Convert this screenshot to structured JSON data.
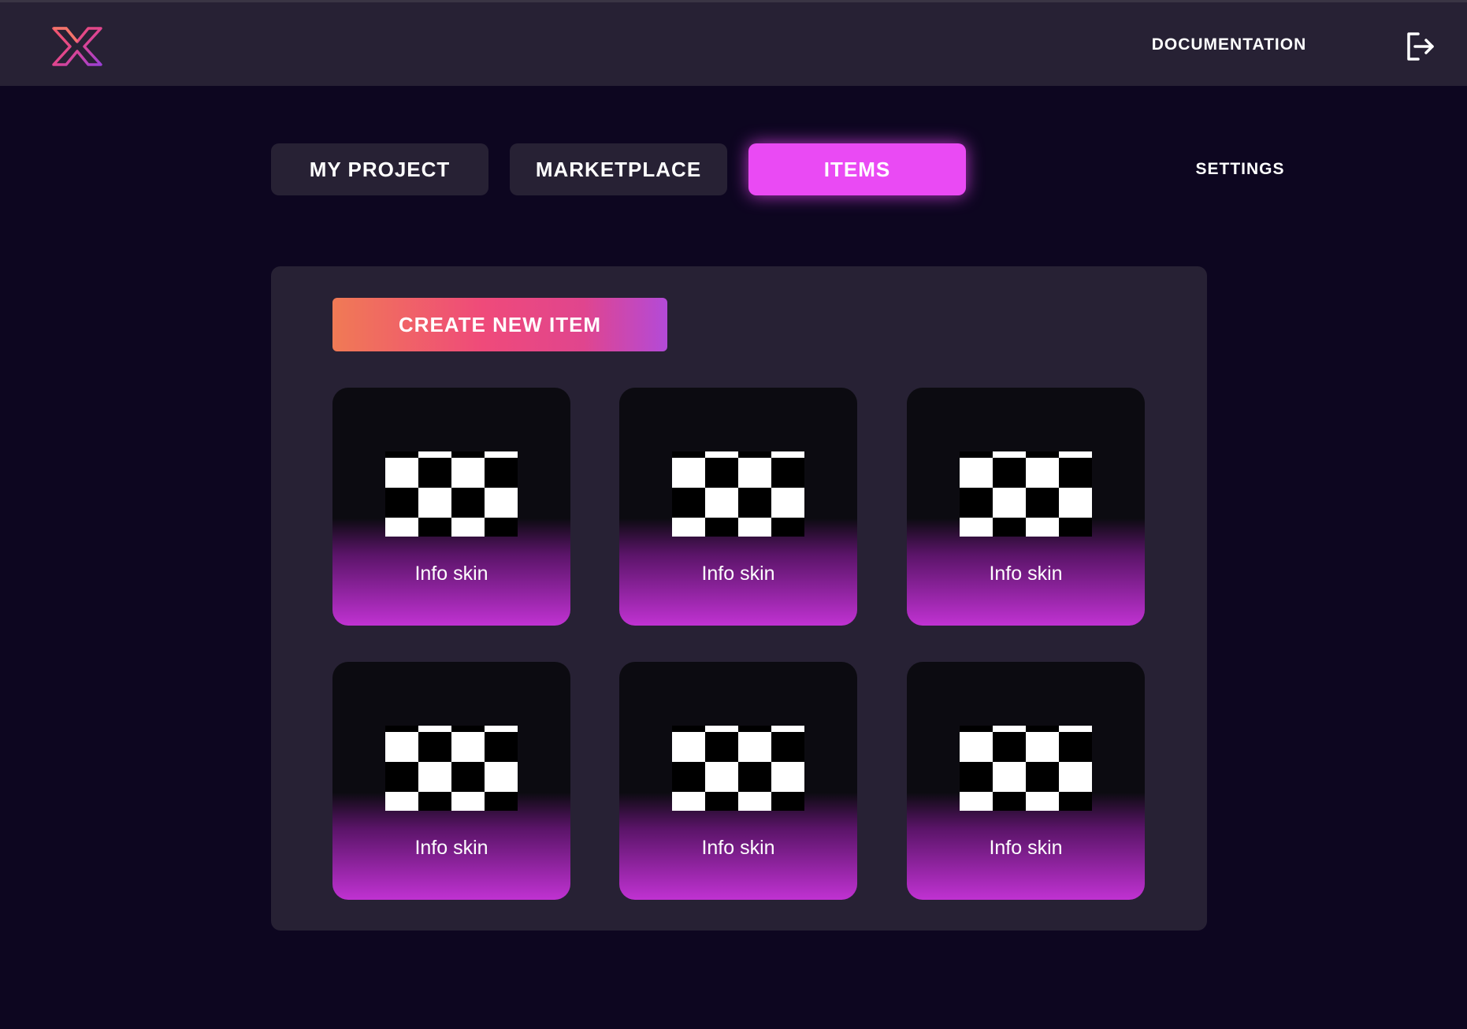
{
  "header": {
    "logo_icon": "x-logo-icon",
    "documentation_label": "DOCUMENTATION",
    "logout_icon": "logout-icon"
  },
  "tabs": [
    {
      "label": "MY PROJECT",
      "active": false
    },
    {
      "label": "MARKETPLACE",
      "active": false
    },
    {
      "label": "ITEMS",
      "active": true
    }
  ],
  "settings_label": "SETTINGS",
  "panel": {
    "create_button_label": "CREATE NEW ITEM",
    "items": [
      {
        "label": "Info skin",
        "thumbnail_icon": "checkerboard-placeholder-icon"
      },
      {
        "label": "Info skin",
        "thumbnail_icon": "checkerboard-placeholder-icon"
      },
      {
        "label": "Info skin",
        "thumbnail_icon": "checkerboard-placeholder-icon"
      },
      {
        "label": "Info skin",
        "thumbnail_icon": "checkerboard-placeholder-icon"
      },
      {
        "label": "Info skin",
        "thumbnail_icon": "checkerboard-placeholder-icon"
      },
      {
        "label": "Info skin",
        "thumbnail_icon": "checkerboard-placeholder-icon"
      }
    ]
  },
  "colors": {
    "background": "#0d0620",
    "surface": "#272134",
    "accent": "#ea4af4",
    "card_gradient_end": "#c032d2"
  }
}
